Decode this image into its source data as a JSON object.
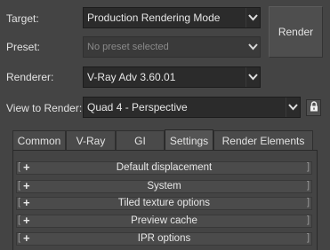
{
  "target": {
    "label": "Target:",
    "value": "Production Rendering Mode"
  },
  "preset": {
    "label": "Preset:",
    "placeholder": "No preset selected"
  },
  "renderer": {
    "label": "Renderer:",
    "value": "V-Ray Adv 3.60.01"
  },
  "view": {
    "label": "View to Render:",
    "value": "Quad 4 - Perspective"
  },
  "render_button": "Render",
  "tabs": [
    {
      "label": "Common"
    },
    {
      "label": "V-Ray"
    },
    {
      "label": "GI"
    },
    {
      "label": "Settings",
      "active": true
    },
    {
      "label": "Render Elements"
    }
  ],
  "rollouts": [
    {
      "label": "Default displacement",
      "expand": "+"
    },
    {
      "label": "System",
      "expand": "+"
    },
    {
      "label": "Tiled texture options",
      "expand": "+"
    },
    {
      "label": "Preview cache",
      "expand": "+"
    },
    {
      "label": "IPR options",
      "expand": "+"
    }
  ],
  "colors": {
    "background": "#444444",
    "field": "#2b2b2b",
    "text": "#e2e2e2"
  }
}
